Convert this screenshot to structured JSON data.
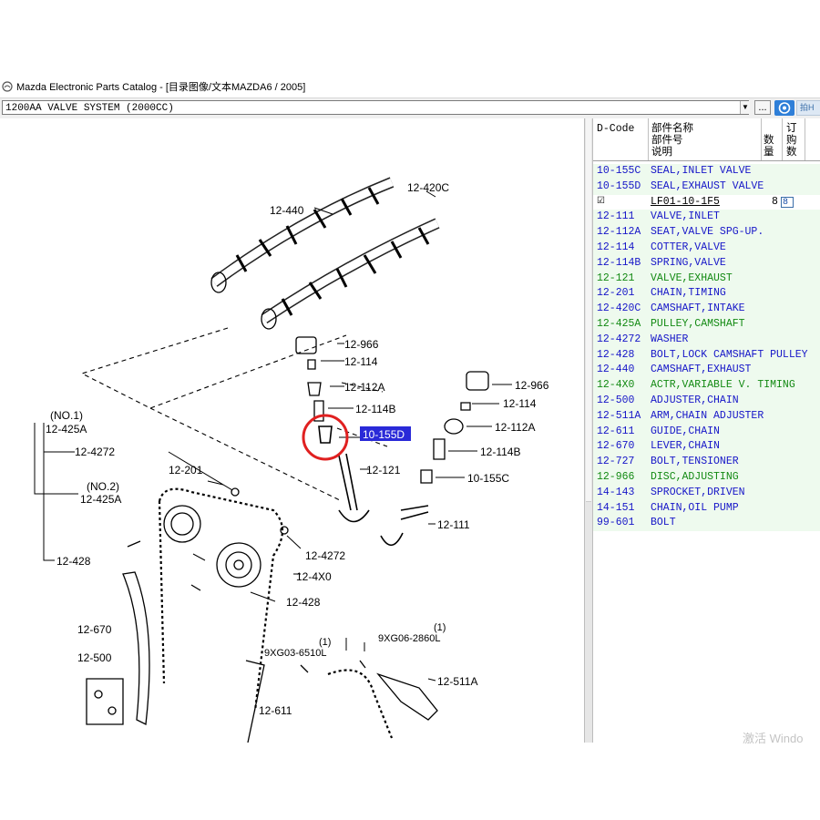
{
  "window": {
    "title": "Mazda Electronic Parts Catalog - [目录图像/文本MAZDA6 / 2005]"
  },
  "toolbar": {
    "combo_value": "1200AA  VALVE SYSTEM (2000CC)",
    "browse_label": "...",
    "ext_label": "拍H"
  },
  "parts_table": {
    "headers": {
      "dcode": "D-Code",
      "name_line1": "部件名称",
      "name_line2": "部件号",
      "name_line3": "说明",
      "qty": "数量",
      "order_line1": "订",
      "order_line2": "购数"
    },
    "rows": [
      {
        "code": "10-155C",
        "name": "SEAL,INLET VALVE",
        "color": "#1616c8"
      },
      {
        "code": "10-155D",
        "name": "SEAL,EXHAUST VALVE",
        "color": "#1616c8"
      },
      {
        "code": "",
        "name": "LF01-10-1F5",
        "qty": "8",
        "order": "8",
        "checkbox": "☑"
      },
      {
        "code": "12-111",
        "name": "VALVE,INLET",
        "color": "#1616c8"
      },
      {
        "code": "12-112A",
        "name": "SEAT,VALVE SPG-UP.",
        "color": "#1616c8"
      },
      {
        "code": "12-114",
        "name": "COTTER,VALVE",
        "color": "#1616c8"
      },
      {
        "code": "12-114B",
        "name": "SPRING,VALVE",
        "color": "#1616c8"
      },
      {
        "code": "12-121",
        "name": "VALVE,EXHAUST",
        "color": "#138a13"
      },
      {
        "code": "12-201",
        "name": "CHAIN,TIMING",
        "color": "#1616c8"
      },
      {
        "code": "12-420C",
        "name": "CAMSHAFT,INTAKE",
        "color": "#1616c8"
      },
      {
        "code": "12-425A",
        "name": "PULLEY,CAMSHAFT",
        "color": "#138a13"
      },
      {
        "code": "12-4272",
        "name": "WASHER",
        "color": "#1616c8"
      },
      {
        "code": "12-428",
        "name": "BOLT,LOCK CAMSHAFT PULLEY",
        "color": "#1616c8"
      },
      {
        "code": "12-440",
        "name": "CAMSHAFT,EXHAUST",
        "color": "#1616c8"
      },
      {
        "code": "12-4X0",
        "name": "ACTR,VARIABLE V. TIMING",
        "color": "#138a13"
      },
      {
        "code": "12-500",
        "name": "ADJUSTER,CHAIN",
        "color": "#1616c8"
      },
      {
        "code": "12-511A",
        "name": "ARM,CHAIN ADJUSTER",
        "color": "#1616c8"
      },
      {
        "code": "12-611",
        "name": "GUIDE,CHAIN",
        "color": "#1616c8"
      },
      {
        "code": "12-670",
        "name": "LEVER,CHAIN",
        "color": "#1616c8"
      },
      {
        "code": "12-727",
        "name": "BOLT,TENSIONER",
        "color": "#1616c8"
      },
      {
        "code": "12-966",
        "name": "DISC,ADJUSTING",
        "color": "#138a13"
      },
      {
        "code": "14-143",
        "name": "SPROCKET,DRIVEN",
        "color": "#1616c8"
      },
      {
        "code": "14-151",
        "name": "CHAIN,OIL PUMP",
        "color": "#1616c8"
      },
      {
        "code": "99-601",
        "name": "BOLT",
        "color": "#1616c8"
      }
    ]
  },
  "diagram": {
    "labels": {
      "l12440": "12-440",
      "l12420c": "12-420C",
      "l12966a": "12-966",
      "l12114a": "12-114",
      "l12112aa": "12-112A",
      "l12114ba": "12-114B",
      "l10155d": "10-155D",
      "l12121": "12-121",
      "l12966b": "12-966",
      "l12114b": "12-114",
      "l12112ab": "12-112A",
      "l12114bb": "12-114B",
      "l10155c": "10-155C",
      "l12111": "12-111",
      "lno1": "(NO.1)",
      "l12425a1": "12-425A",
      "l124272a": "12-4272",
      "lno2": "(NO.2)",
      "l12425a2": "12-425A",
      "l12201": "12-201",
      "l12428a": "12-428",
      "l124272b": "12-4272",
      "l124x0": "12-4X0",
      "l12428b": "12-428",
      "l12670": "12-670",
      "l12500": "12-500",
      "l9xg03": "9XG03-6510L",
      "l9xg03n": "(1)",
      "l9xg06": "9XG06-2860L",
      "l9xg06n": "(1)",
      "l12611": "12-611",
      "l12511a": "12-511A"
    },
    "selected_label": "10-155D",
    "highlight_color": "#2a2ad8",
    "circle_color": "#e02020"
  },
  "watermark": "激活 Windo"
}
